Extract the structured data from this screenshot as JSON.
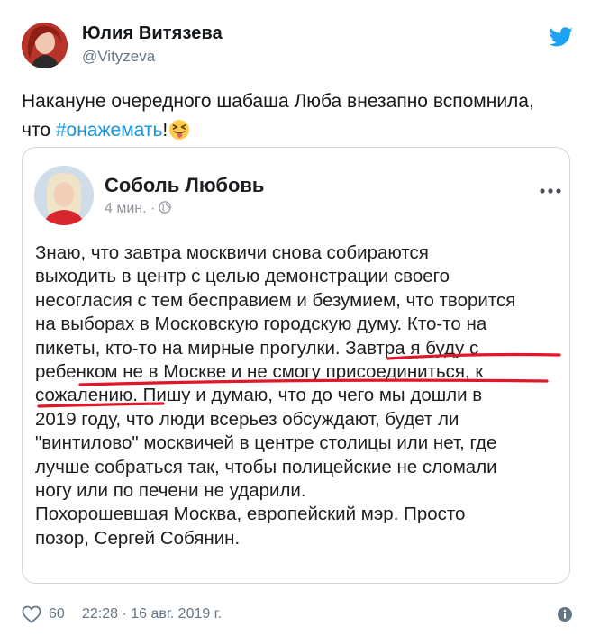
{
  "author": {
    "name": "Юлия Витязева",
    "handle": "@Vityzeva"
  },
  "tweet": {
    "text_line1": "Накануне очередного шабаша Люба внезапно вспомнила,",
    "text_line2_prefix": "что ",
    "hashtag": "#онажемать",
    "text_line2_suffix": "!",
    "emoji": "squinting-face-with-tongue"
  },
  "embedded_post": {
    "name": "Соболь Любовь",
    "time": "4 мин. ·",
    "lines": [
      "Знаю, что завтра москвичи снова собираются",
      "выходить в центр с целью демонстрации своего",
      "несогласия с тем бесправием и безумием, что творится",
      "на выборах в Московскую городскую думу. Кто-то на",
      "пикеты, кто-то на мирные прогулки. Завтра я буду с",
      "ребенком не в Москве и не смогу присоединиться, к",
      "сожалению. Пишу и думаю, что до чего мы дошли в",
      "2019 году, что люди всерьез обсуждают, будет ли",
      "\"винтилово\" москвичей в центре столицы или нет, где",
      "лучше собраться так, чтобы полицейские не сломали",
      "ногу или по печени не ударили.",
      "Похорошевшая Москва, европейский мэр. Просто",
      "позор, Сергей Собянин."
    ],
    "underline_color": "#e0162b"
  },
  "footer": {
    "likes": "60",
    "timestamp": "22:28 · 16 авг. 2019 г."
  },
  "colors": {
    "link": "#1b95e0",
    "secondary": "#657786",
    "twitter_blue": "#1da1f2"
  }
}
